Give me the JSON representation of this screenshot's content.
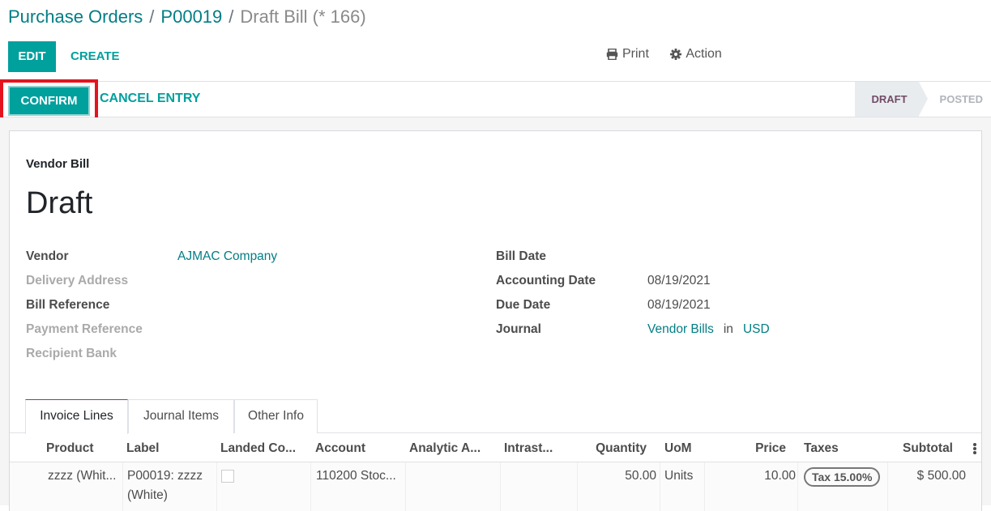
{
  "breadcrumb": {
    "items": [
      "Purchase Orders",
      "P00019"
    ],
    "current": "Draft Bill (* 166)",
    "separator": "/"
  },
  "toolbar": {
    "edit_label": "EDIT",
    "create_label": "CREATE",
    "print_label": "Print",
    "action_label": "Action"
  },
  "statusbar": {
    "confirm_label": "CONFIRM",
    "cancel_label": "CANCEL ENTRY",
    "stages": [
      {
        "label": "DRAFT",
        "active": true
      },
      {
        "label": "POSTED",
        "active": false
      }
    ],
    "highlight_color": "#e4141e"
  },
  "sheet": {
    "doc_type": "Vendor Bill",
    "doc_name": "Draft",
    "left_fields": [
      {
        "label": "Vendor",
        "value": "AJMAC Company",
        "muted": false
      },
      {
        "label": "Delivery Address",
        "value": "",
        "muted": true
      },
      {
        "label": "Bill Reference",
        "value": "",
        "muted": false
      },
      {
        "label": "Payment Reference",
        "value": "",
        "muted": true
      },
      {
        "label": "Recipient Bank",
        "value": "",
        "muted": true
      }
    ],
    "right_fields": [
      {
        "label": "Bill Date",
        "value": ""
      },
      {
        "label": "Accounting Date",
        "value": "08/19/2021"
      },
      {
        "label": "Due Date",
        "value": "08/19/2021"
      },
      {
        "label": "Journal",
        "value": "Vendor Bills",
        "in_text": "in",
        "currency": "USD"
      }
    ]
  },
  "tabs": [
    {
      "label": "Invoice Lines",
      "active": true
    },
    {
      "label": "Journal Items",
      "active": false
    },
    {
      "label": "Other Info",
      "active": false
    }
  ],
  "table": {
    "columns": [
      "Product",
      "Label",
      "Landed Co...",
      "Account",
      "Analytic A...",
      "Intrast...",
      "Quantity",
      "UoM",
      "Price",
      "Taxes",
      "Subtotal"
    ],
    "rows": [
      {
        "product": "zzzz (Whit...",
        "label_line1": "P00019: zzzz",
        "label_line2": "(White)",
        "landed_cost": false,
        "account": "110200 Stoc...",
        "analytic": "",
        "intrastat": "",
        "quantity": "50.00",
        "uom": "Units",
        "price": "10.00",
        "taxes": "Tax 15.00%",
        "subtotal": "$ 500.00"
      }
    ]
  },
  "colors": {
    "primary": "#00a09d",
    "link": "#017e84",
    "stage_active": "#714b67"
  }
}
